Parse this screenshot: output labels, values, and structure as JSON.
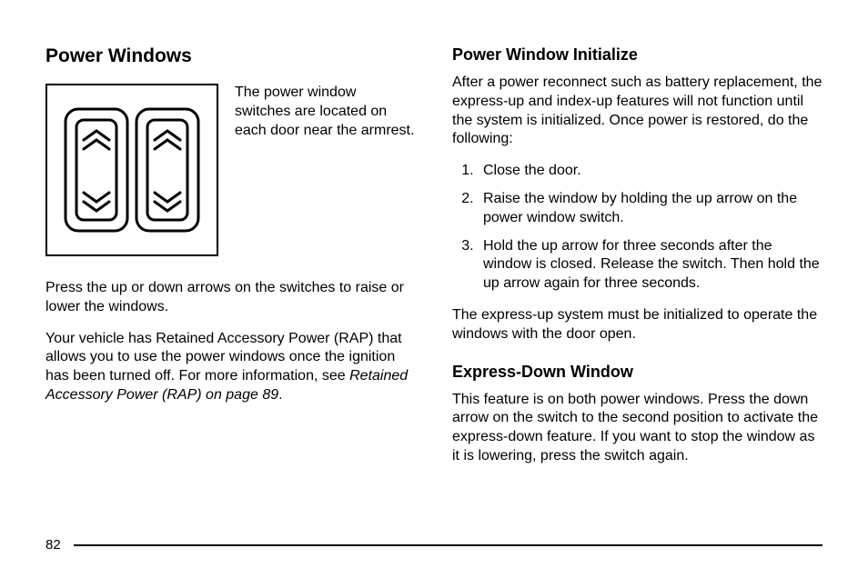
{
  "left": {
    "heading": "Power Windows",
    "fig_caption": "The power window switches are located on each door near the armrest.",
    "para1": "Press the up or down arrows on the switches to raise or lower the windows.",
    "para2_a": "Your vehicle has Retained Accessory Power (RAP) that allows you to use the power windows once the ignition has been turned off. For more information, see ",
    "para2_ref": "Retained Accessory Power (RAP) on page 89",
    "para2_b": "."
  },
  "right": {
    "heading1": "Power Window Initialize",
    "para1": "After a power reconnect such as battery replacement, the express-up and index-up features will not function until the system is initialized. Once power is restored, do the following:",
    "steps": [
      "Close the door.",
      "Raise the window by holding the up arrow on the power window switch.",
      "Hold the up arrow for three seconds after the window is closed. Release the switch. Then hold the up arrow again for three seconds."
    ],
    "para2": "The express-up system must be initialized to operate the windows with the door open.",
    "heading2": "Express-Down Window",
    "para3": "This feature is on both power windows. Press the down arrow on the switch to the second position to activate the express-down feature. If you want to stop the window as it is lowering, press the switch again."
  },
  "footer": {
    "page": "82"
  }
}
